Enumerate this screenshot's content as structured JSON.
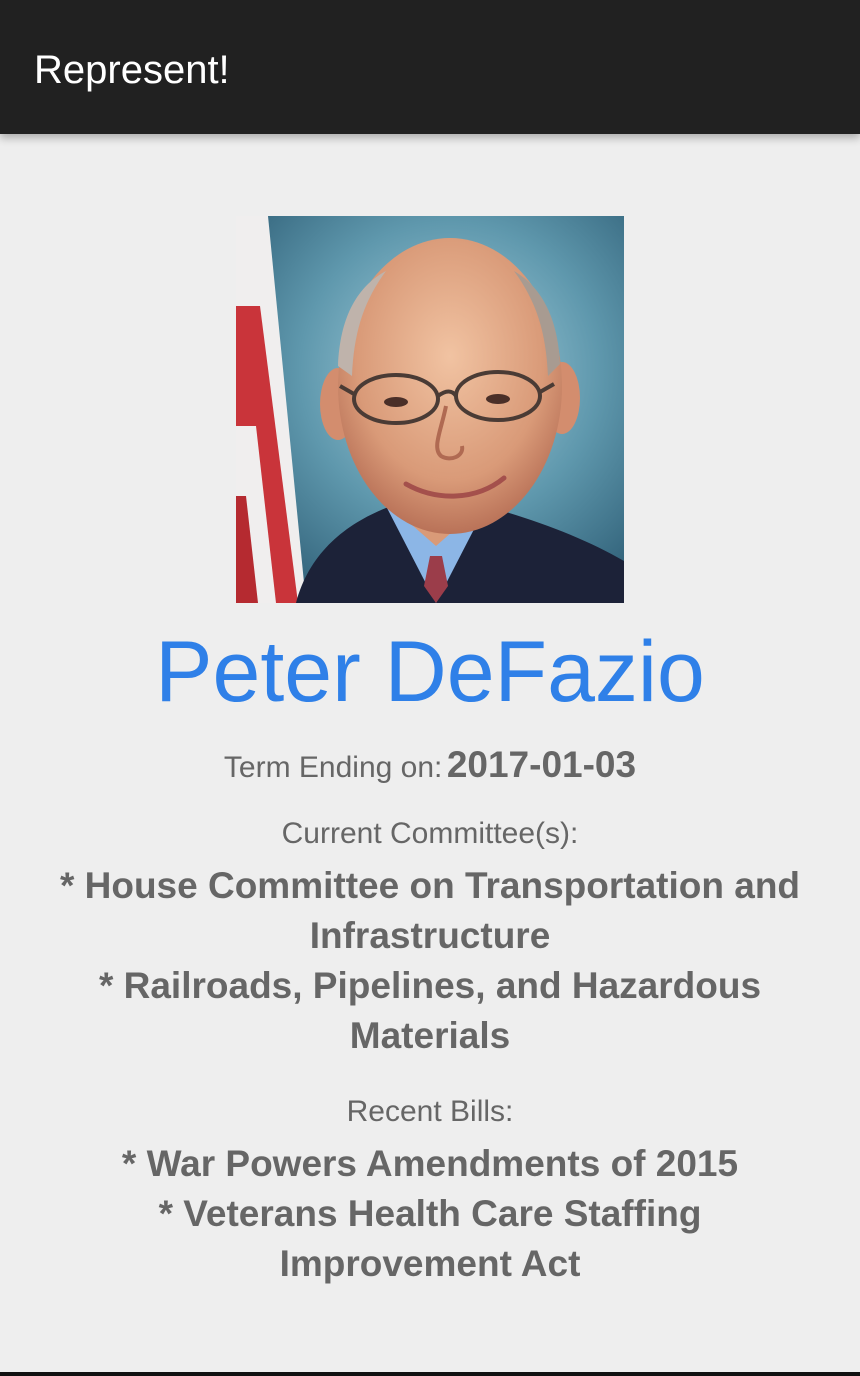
{
  "app": {
    "title": "Represent!"
  },
  "representative": {
    "name": "Peter DeFazio",
    "photo_icon": "portrait-photo",
    "term_label": "Term Ending on:",
    "term_end": "2017-01-03"
  },
  "committees": {
    "label": "Current Committee(s):",
    "items": [
      "* House Committee on Transportation and Infrastructure",
      "* Railroads, Pipelines, and Hazardous Materials"
    ]
  },
  "bills": {
    "label": "Recent Bills:",
    "items": [
      "* War Powers Amendments of 2015",
      "* Veterans Health Care Staffing Improvement Act"
    ]
  },
  "colors": {
    "appbar": "#212121",
    "name": "#2f80e8",
    "text": "#666666",
    "background": "#eeeeee"
  }
}
